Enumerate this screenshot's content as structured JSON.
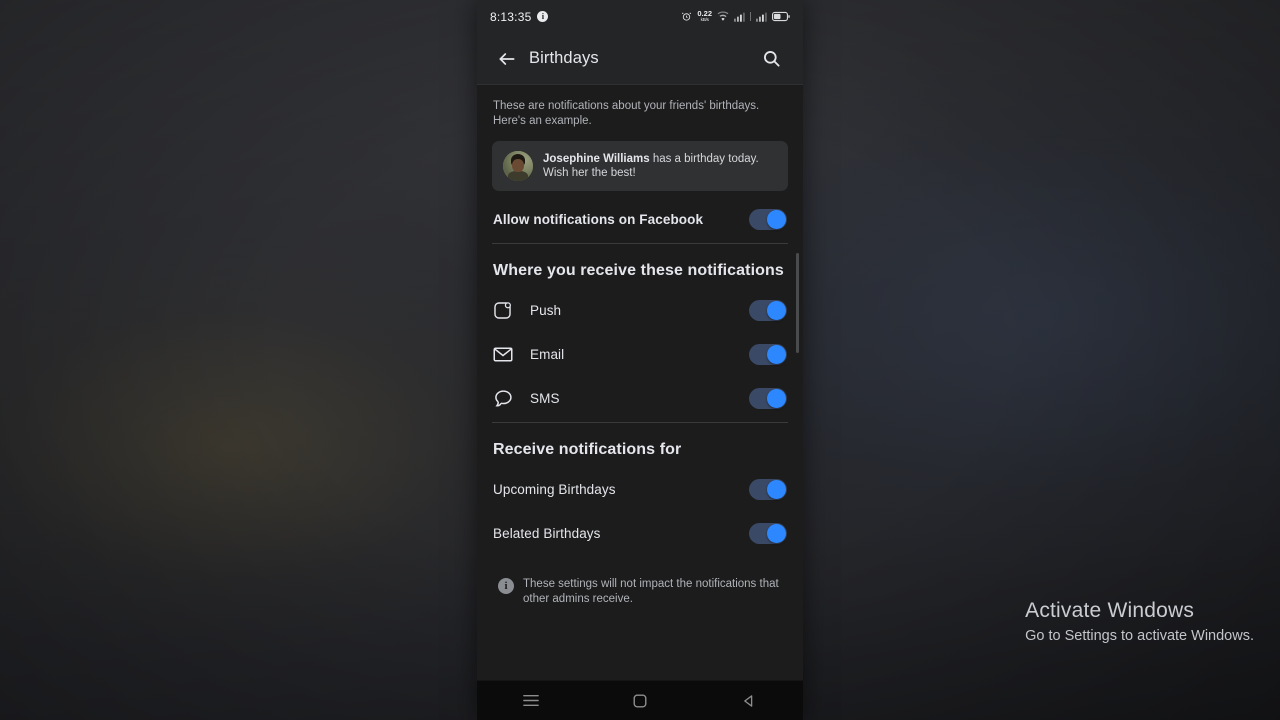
{
  "desktop": {
    "watermark": {
      "title": "Activate Windows",
      "subtitle": "Go to Settings to activate Windows."
    }
  },
  "phone": {
    "statusbar": {
      "clock": "8:13:35",
      "info_badge": "i",
      "netspeed_value": "0.22",
      "netspeed_unit": "kB/s",
      "icons": [
        "alarm-icon",
        "network-speed-icon",
        "wifi-icon",
        "signal-1-icon",
        "signal-2-icon",
        "battery-icon"
      ]
    },
    "appbar": {
      "back_icon": "back-arrow-icon",
      "title": "Birthdays",
      "search_icon": "search-icon"
    },
    "content": {
      "intro": "These are notifications about your friends' birthdays. Here's an example.",
      "example": {
        "name": "Josephine Williams",
        "message": " has a birthday today.",
        "message_line2": "Wish her the best!"
      },
      "allow_row": {
        "label": "Allow notifications on Facebook",
        "toggle_on": true
      },
      "section_where": {
        "title": "Where you receive these notifications",
        "rows": [
          {
            "label": "Push",
            "icon": "push-notification-icon",
            "toggle_on": true
          },
          {
            "label": "Email",
            "icon": "envelope-icon",
            "toggle_on": true
          },
          {
            "label": "SMS",
            "icon": "chat-bubble-icon",
            "toggle_on": true
          }
        ]
      },
      "section_receive": {
        "title": "Receive notifications for",
        "rows": [
          {
            "label": "Upcoming Birthdays",
            "toggle_on": true
          },
          {
            "label": "Belated Birthdays",
            "toggle_on": true
          }
        ]
      },
      "note": {
        "icon": "i",
        "text": "These settings will not impact the notifications that other admins receive."
      }
    },
    "navbar": {
      "recents_icon": "menu-recents-icon",
      "home_icon": "home-square-icon",
      "back_icon": "back-triangle-icon"
    },
    "colors": {
      "accent_blue": "#2d88ff",
      "toggle_track": "#3a4a66",
      "surface": "#242526",
      "background": "#1c1c1d",
      "text_primary": "#e4e6eb",
      "text_secondary": "#b0b3b8"
    }
  }
}
